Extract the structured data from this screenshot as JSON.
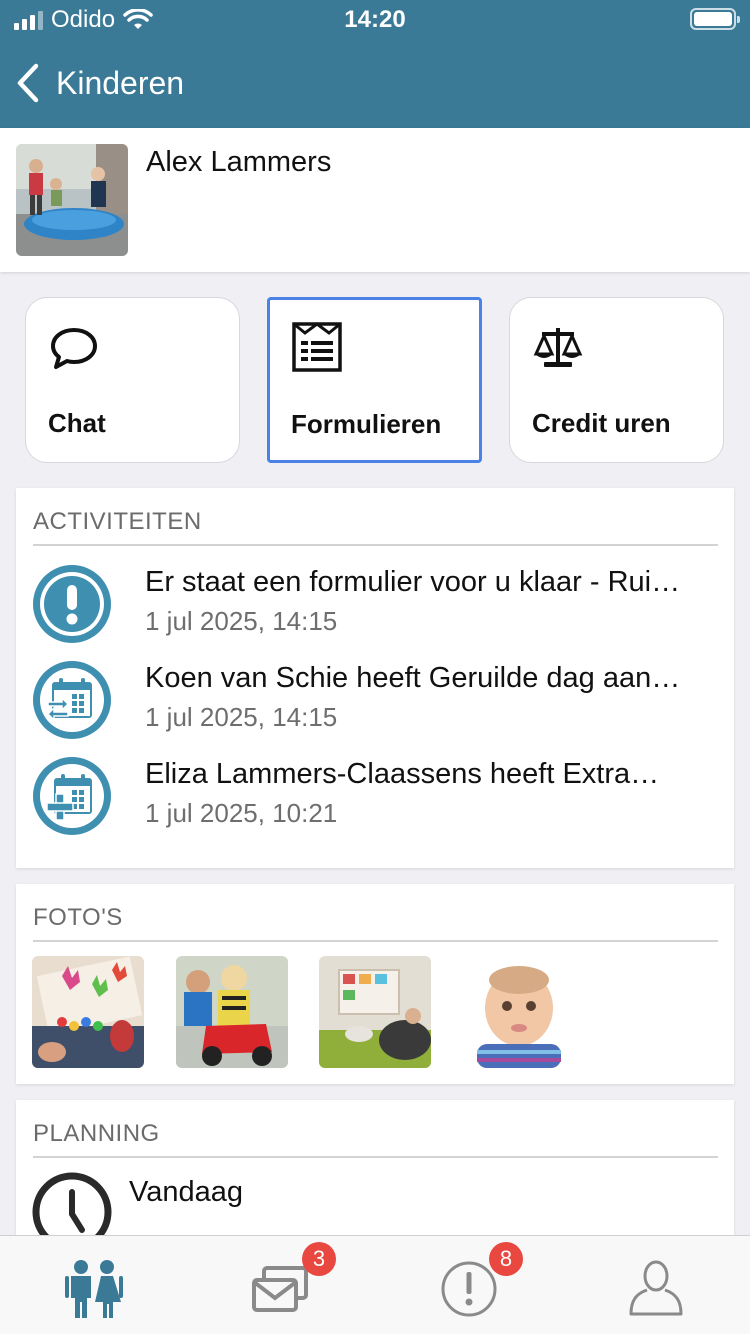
{
  "status_bar": {
    "carrier": "Odido",
    "time": "14:20"
  },
  "nav": {
    "back_label": "Kinderen"
  },
  "child": {
    "name": "Alex Lammers"
  },
  "actions": [
    {
      "label": "Chat",
      "icon": "chat-bubble-icon"
    },
    {
      "label": "Formulieren",
      "icon": "form-icon",
      "selected": true
    },
    {
      "label": "Credit uren",
      "icon": "scales-icon"
    }
  ],
  "activities": {
    "title": "ACTIVITEITEN",
    "items": [
      {
        "text": "Er staat een formulier voor u klaar - Rui…",
        "date": "1 jul 2025, 14:15",
        "icon": "exclamation-icon"
      },
      {
        "text": "Koen van Schie heeft Geruilde dag aan…",
        "date": "1 jul 2025, 14:15",
        "icon": "calendar-swap-icon"
      },
      {
        "text": "Eliza Lammers-Claassens heeft Extra…",
        "date": "1 jul 2025, 10:21",
        "icon": "calendar-plus-icon"
      }
    ]
  },
  "photos": {
    "title": "FOTO'S",
    "items": [
      "painting-hands-photo",
      "child-on-ride-toy-photo",
      "playroom-photo",
      "baby-photo"
    ]
  },
  "planning": {
    "title": "PLANNING",
    "today_label": "Vandaag"
  },
  "tab_bar": {
    "tabs": [
      {
        "name": "children",
        "icon": "children-icon",
        "active": true
      },
      {
        "name": "messages",
        "icon": "messages-icon",
        "badge": "3"
      },
      {
        "name": "notifications",
        "icon": "alert-icon",
        "badge": "8"
      },
      {
        "name": "profile",
        "icon": "person-icon"
      }
    ]
  },
  "colors": {
    "header": "#3a7a97",
    "icon_teal": "#3f8fb0",
    "selected_border": "#4a82e8",
    "badge": "#e8483f"
  }
}
